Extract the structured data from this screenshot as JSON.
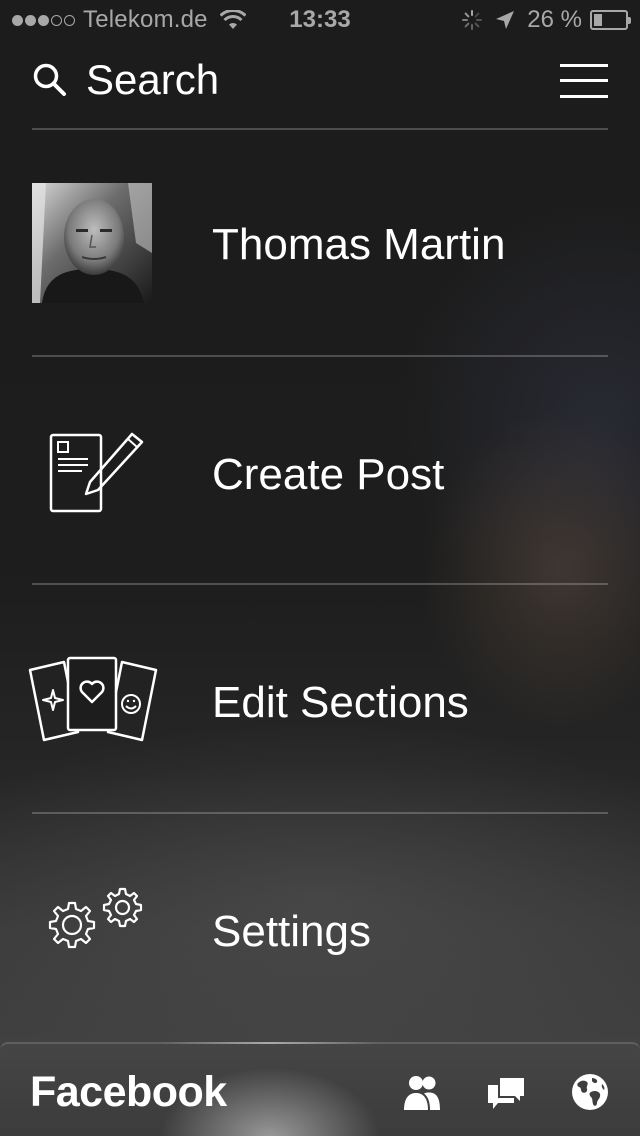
{
  "status_bar": {
    "signal_strength": 3,
    "signal_max": 5,
    "carrier": "Telekom.de",
    "time": "13:33",
    "battery_text": "26 %",
    "battery_level": 0.26,
    "icons": [
      "wifi-icon",
      "activity-icon",
      "location-arrow-icon",
      "battery-icon"
    ]
  },
  "header": {
    "search_label": "Search",
    "icons": [
      "search-icon",
      "hamburger-menu-icon"
    ]
  },
  "menu": {
    "items": [
      {
        "label": "Thomas Martin",
        "icon": "profile-photo"
      },
      {
        "label": "Create Post",
        "icon": "create-post-icon"
      },
      {
        "label": "Edit Sections",
        "icon": "edit-sections-icon"
      },
      {
        "label": "Settings",
        "icon": "settings-gears-icon"
      }
    ]
  },
  "bottom_bar": {
    "brand": "Facebook",
    "icons": [
      "friends-icon",
      "messages-icon",
      "globe-icon"
    ]
  },
  "colors": {
    "text": "#ffffff",
    "status_text": "#a8a8a8",
    "background": "#1d1d1d",
    "divider": "#4a4a4a"
  }
}
